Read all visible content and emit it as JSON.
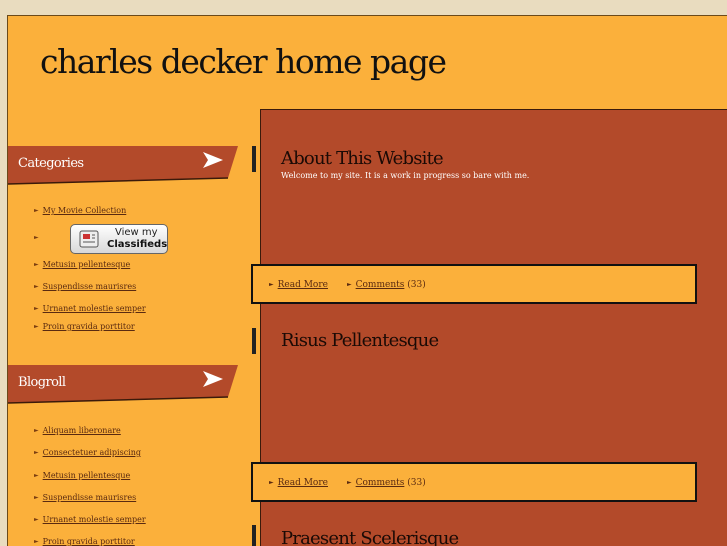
{
  "site": {
    "title": "charles decker home page"
  },
  "sidebar": {
    "categories": {
      "heading": "Categories",
      "items": [
        {
          "label": "My Movie Collection"
        },
        {
          "label": ""
        },
        {
          "label": "Metusin pellentesque"
        },
        {
          "label": "Suspendisse maurisres"
        },
        {
          "label": "Urnanet molestie semper"
        },
        {
          "label": "Proin gravida porttitor"
        }
      ],
      "classifieds": {
        "line1": "View my",
        "line2": "Classifieds"
      }
    },
    "blogroll": {
      "heading": "Blogroll",
      "items": [
        {
          "label": "Aliquam liberonare"
        },
        {
          "label": "Consectetuer adipiscing"
        },
        {
          "label": "Metusin pellentesque"
        },
        {
          "label": "Suspendisse maurisres"
        },
        {
          "label": "Urnanet molestie semper"
        },
        {
          "label": "Proin gravida porttitor"
        }
      ]
    }
  },
  "posts": [
    {
      "title": "About This Website",
      "excerpt": "Welcome to my site. It is a work in progress so bare with me.",
      "read_more": "Read More",
      "comments": "Comments",
      "comment_count": "(33)"
    },
    {
      "title": "Risus Pellentesque",
      "excerpt": "",
      "read_more": "Read More",
      "comments": "Comments",
      "comment_count": "(33)"
    },
    {
      "title": "Praesent Scelerisque",
      "excerpt": "",
      "read_more": "",
      "comments": "",
      "comment_count": ""
    }
  ],
  "colors": {
    "background": "#fbb03b",
    "content": "#b34a2a",
    "accent": "#b34a2a"
  },
  "icons": {
    "heading_arrow": "arrow-right-icon",
    "bullet": "bullet-arrow-icon",
    "classifieds": "newspaper-icon"
  }
}
